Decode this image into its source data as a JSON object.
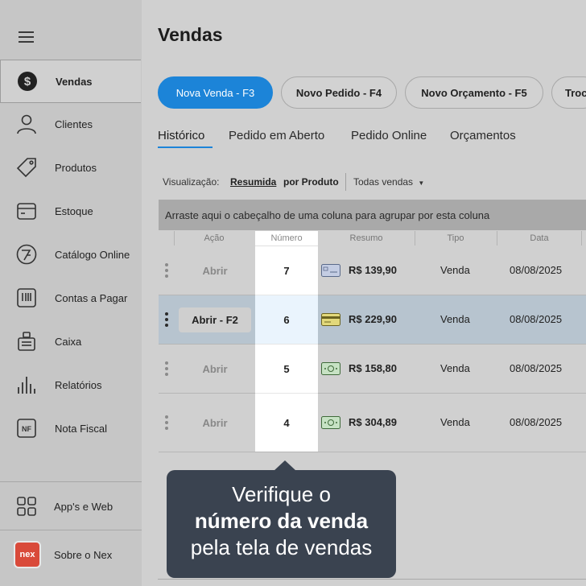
{
  "sidebar": {
    "items": [
      {
        "label": "Vendas",
        "icon": "dollar-icon",
        "active": true
      },
      {
        "label": "Clientes",
        "icon": "user-icon"
      },
      {
        "label": "Produtos",
        "icon": "tag-icon"
      },
      {
        "label": "Estoque",
        "icon": "box-icon"
      },
      {
        "label": "Catálogo Online",
        "icon": "catalog-icon"
      },
      {
        "label": "Contas a Pagar",
        "icon": "barcode-icon"
      },
      {
        "label": "Caixa",
        "icon": "cash-register-icon"
      },
      {
        "label": "Relatórios",
        "icon": "bar-chart-icon"
      },
      {
        "label": "Nota Fiscal",
        "icon": "nf-icon"
      }
    ],
    "bottom": [
      {
        "label": "App's e Web",
        "icon": "grid-icon"
      },
      {
        "label": "Sobre o Nex",
        "icon": "nex-logo",
        "logo_text": "nex"
      }
    ]
  },
  "main": {
    "title": "Vendas",
    "buttons": [
      "Nova Venda - F3",
      "Novo Pedido - F4",
      "Novo Orçamento - F5",
      "Troc"
    ],
    "tabs": [
      "Histórico",
      "Pedido em Aberto",
      "Pedido Online",
      "Orçamentos"
    ],
    "visualizacao": {
      "label": "Visualização:",
      "options": [
        "Resumida",
        "por Produto"
      ],
      "dropdown": "Todas vendas"
    },
    "group_bar": "Arraste aqui o cabeçalho de uma coluna para agrupar por esta coluna",
    "columns": [
      "Ação",
      "Número",
      "Resumo",
      "Tipo",
      "Data"
    ],
    "rows": [
      {
        "acao": "Abrir",
        "numero": "7",
        "resumo": "R$ 139,90",
        "pay_icon": "card-icon",
        "tipo": "Venda",
        "data": "08/08/2025"
      },
      {
        "acao": "Abrir - F2",
        "numero": "6",
        "resumo": "R$ 229,90",
        "pay_icon": "credit-card-icon",
        "tipo": "Venda",
        "data": "08/08/2025",
        "selected": true
      },
      {
        "acao": "Abrir",
        "numero": "5",
        "resumo": "R$ 158,80",
        "pay_icon": "cash-icon",
        "tipo": "Venda",
        "data": "08/08/2025"
      },
      {
        "acao": "Abrir",
        "numero": "4",
        "resumo": "R$ 304,89",
        "pay_icon": "cash-icon",
        "tipo": "Venda",
        "data": "08/08/2025"
      }
    ]
  },
  "tooltip": {
    "line1": "Verifique o",
    "line2": "número da venda",
    "line3": "pela tela de vendas"
  },
  "colors": {
    "primary": "#1c84d8",
    "tooltip_bg": "#3a4350",
    "nex_brand": "#d94a3a"
  }
}
